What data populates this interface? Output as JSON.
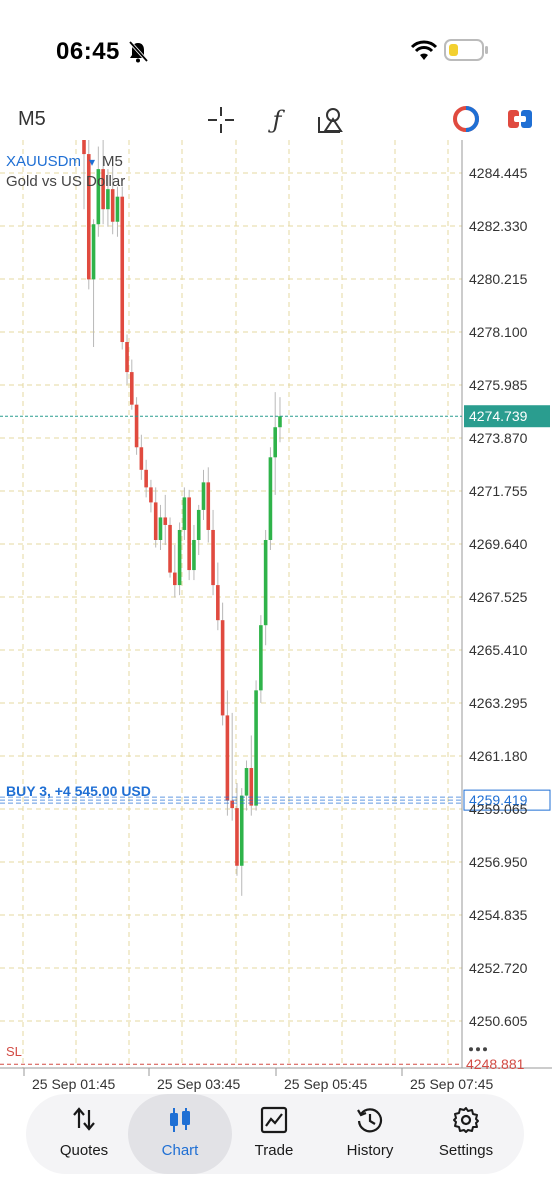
{
  "status": {
    "time": "06:45"
  },
  "toolbar": {
    "timeframe": "M5"
  },
  "chart_data": {
    "type": "candlestick",
    "symbol": "XAUUSDm",
    "symbol_tf": "M5",
    "description": "Gold vs US Dollar",
    "y_ticks": [
      "4284.445",
      "4282.330",
      "4280.215",
      "4278.100",
      "4275.985",
      "4273.870",
      "4271.755",
      "4269.640",
      "4267.525",
      "4265.410",
      "4263.295",
      "4261.180",
      "4259.065",
      "4256.950",
      "4254.835",
      "4252.720",
      "4250.605"
    ],
    "ylim": [
      4248.0,
      4286.5
    ],
    "x_ticks": [
      "25 Sep 01:45",
      "25 Sep 03:45",
      "25 Sep 05:45",
      "25 Sep 07:45"
    ],
    "current_price": "4274.739",
    "current_price_value": 4274.739,
    "position_price": "4259.419",
    "position_price_value": 4259.419,
    "position_label": "BUY 3, +4 545.00 USD",
    "sl_label": "SL",
    "sl_price": "4248.881",
    "sl_price_value": 4248.881,
    "candles": [
      {
        "o": 4285.8,
        "h": 4286.5,
        "l": 4283.0,
        "c": 4285.2
      },
      {
        "o": 4285.2,
        "h": 4286.5,
        "l": 4279.8,
        "c": 4280.2
      },
      {
        "o": 4280.2,
        "h": 4282.6,
        "l": 4277.5,
        "c": 4282.4
      },
      {
        "o": 4282.4,
        "h": 4285.5,
        "l": 4281.9,
        "c": 4284.6
      },
      {
        "o": 4284.6,
        "h": 4285.8,
        "l": 4282.4,
        "c": 4283.0
      },
      {
        "o": 4283.0,
        "h": 4284.6,
        "l": 4282.3,
        "c": 4283.8
      },
      {
        "o": 4283.8,
        "h": 4284.9,
        "l": 4282.0,
        "c": 4282.5
      },
      {
        "o": 4282.5,
        "h": 4283.9,
        "l": 4281.9,
        "c": 4283.5
      },
      {
        "o": 4283.5,
        "h": 4283.9,
        "l": 4277.4,
        "c": 4277.7
      },
      {
        "o": 4277.7,
        "h": 4278.0,
        "l": 4276.0,
        "c": 4276.5
      },
      {
        "o": 4276.5,
        "h": 4277.0,
        "l": 4275.0,
        "c": 4275.2
      },
      {
        "o": 4275.2,
        "h": 4275.5,
        "l": 4273.2,
        "c": 4273.5
      },
      {
        "o": 4273.5,
        "h": 4274.0,
        "l": 4272.2,
        "c": 4272.6
      },
      {
        "o": 4272.6,
        "h": 4273.0,
        "l": 4271.5,
        "c": 4271.9
      },
      {
        "o": 4271.9,
        "h": 4272.2,
        "l": 4270.9,
        "c": 4271.3
      },
      {
        "o": 4271.3,
        "h": 4271.9,
        "l": 4269.5,
        "c": 4269.8
      },
      {
        "o": 4269.8,
        "h": 4271.2,
        "l": 4269.4,
        "c": 4270.7
      },
      {
        "o": 4270.7,
        "h": 4271.6,
        "l": 4269.6,
        "c": 4270.4
      },
      {
        "o": 4270.4,
        "h": 4270.7,
        "l": 4268.3,
        "c": 4268.5
      },
      {
        "o": 4268.5,
        "h": 4269.6,
        "l": 4267.5,
        "c": 4268.0
      },
      {
        "o": 4268.0,
        "h": 4270.5,
        "l": 4267.6,
        "c": 4270.2
      },
      {
        "o": 4270.2,
        "h": 4271.9,
        "l": 4269.8,
        "c": 4271.5
      },
      {
        "o": 4271.5,
        "h": 4271.8,
        "l": 4268.2,
        "c": 4268.6
      },
      {
        "o": 4268.6,
        "h": 4270.4,
        "l": 4268.2,
        "c": 4269.8
      },
      {
        "o": 4269.8,
        "h": 4271.2,
        "l": 4269.2,
        "c": 4271.0
      },
      {
        "o": 4271.0,
        "h": 4272.6,
        "l": 4270.6,
        "c": 4272.1
      },
      {
        "o": 4272.1,
        "h": 4272.7,
        "l": 4269.7,
        "c": 4270.2
      },
      {
        "o": 4270.2,
        "h": 4271.0,
        "l": 4267.6,
        "c": 4268.0
      },
      {
        "o": 4268.0,
        "h": 4268.9,
        "l": 4266.2,
        "c": 4266.6
      },
      {
        "o": 4266.6,
        "h": 4267.3,
        "l": 4262.4,
        "c": 4262.8
      },
      {
        "o": 4262.8,
        "h": 4263.8,
        "l": 4258.8,
        "c": 4259.4
      },
      {
        "o": 4259.4,
        "h": 4262.9,
        "l": 4258.6,
        "c": 4259.1
      },
      {
        "o": 4259.1,
        "h": 4260.1,
        "l": 4256.4,
        "c": 4256.8
      },
      {
        "o": 4256.8,
        "h": 4259.9,
        "l": 4255.6,
        "c": 4259.6
      },
      {
        "o": 4259.6,
        "h": 4261.0,
        "l": 4259.0,
        "c": 4260.7
      },
      {
        "o": 4260.7,
        "h": 4262.0,
        "l": 4258.8,
        "c": 4259.2
      },
      {
        "o": 4259.2,
        "h": 4264.2,
        "l": 4259.0,
        "c": 4263.8
      },
      {
        "o": 4263.8,
        "h": 4266.8,
        "l": 4263.3,
        "c": 4266.4
      },
      {
        "o": 4266.4,
        "h": 4270.2,
        "l": 4265.6,
        "c": 4269.8
      },
      {
        "o": 4269.8,
        "h": 4273.5,
        "l": 4269.4,
        "c": 4273.1
      },
      {
        "o": 4273.1,
        "h": 4275.7,
        "l": 4271.6,
        "c": 4274.3
      },
      {
        "o": 4274.3,
        "h": 4275.5,
        "l": 4273.7,
        "c": 4274.739
      }
    ],
    "colors": {
      "bull": "#2fb34a",
      "bear": "#e04a3f",
      "grid": "#e6d9a0",
      "current": "#2a9d8f",
      "position": "#1f6fd4",
      "sl": "#d24b44"
    }
  },
  "nav": {
    "items": [
      {
        "label": "Quotes"
      },
      {
        "label": "Chart"
      },
      {
        "label": "Trade"
      },
      {
        "label": "History"
      },
      {
        "label": "Settings"
      }
    ]
  }
}
